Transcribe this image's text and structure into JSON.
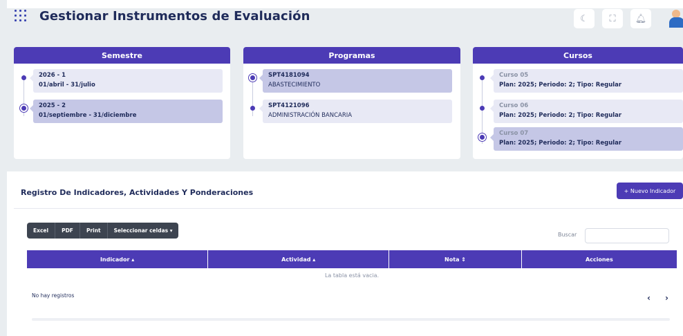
{
  "header": {
    "title": "Gestionar Instrumentos de Evaluación",
    "icons": [
      "apps-grid-icon",
      "moon-icon",
      "fullscreen-icon",
      "bell-icon",
      "user-avatar"
    ]
  },
  "semestre": {
    "title": "Semestre",
    "items": [
      {
        "code": "2026 - 1",
        "range": "01/abril - 31/julio",
        "selected": false
      },
      {
        "code": "2025 - 2",
        "range": "01/septiembre - 31/diciembre",
        "selected": true
      }
    ]
  },
  "programas": {
    "title": "Programas",
    "items": [
      {
        "code": "SPT4181094",
        "name": "ABASTECIMIENTO",
        "selected": true
      },
      {
        "code": "SPT4121096",
        "name": "ADMINISTRACIÓN BANCARIA",
        "selected": false
      }
    ]
  },
  "cursos": {
    "title": "Cursos",
    "items": [
      {
        "name": "Curso 05",
        "detail": "Plan: 2025; Periodo: 2; Tipo: Regular",
        "selected": false
      },
      {
        "name": "Curso 06",
        "detail": "Plan: 2025; Periodo: 2; Tipo: Regular",
        "selected": false
      },
      {
        "name": "Curso 07",
        "detail": "Plan: 2025; Periodo: 2; Tipo: Regular",
        "selected": true
      }
    ]
  },
  "registro": {
    "title": "Registro De Indicadores, Actividades Y Ponderaciones",
    "new_button": "+ Nuevo Indicador",
    "export_buttons": [
      "Excel",
      "PDF",
      "Print",
      "Seleccionar celdas ▾"
    ],
    "search_label": "Buscar",
    "search_value": "",
    "columns": [
      "Indicador ▴",
      "Actividad ▴",
      "Nota ⇕",
      "Acciones"
    ],
    "empty_message": "La tabla está vacia.",
    "footer_info": "No hay registros",
    "prev_label": "‹",
    "next_label": "›"
  },
  "colors": {
    "accent": "#4c3bb5",
    "selected_bg": "#c5c7e6",
    "item_bg": "#e8e9f5",
    "background": "#e9edf0"
  }
}
